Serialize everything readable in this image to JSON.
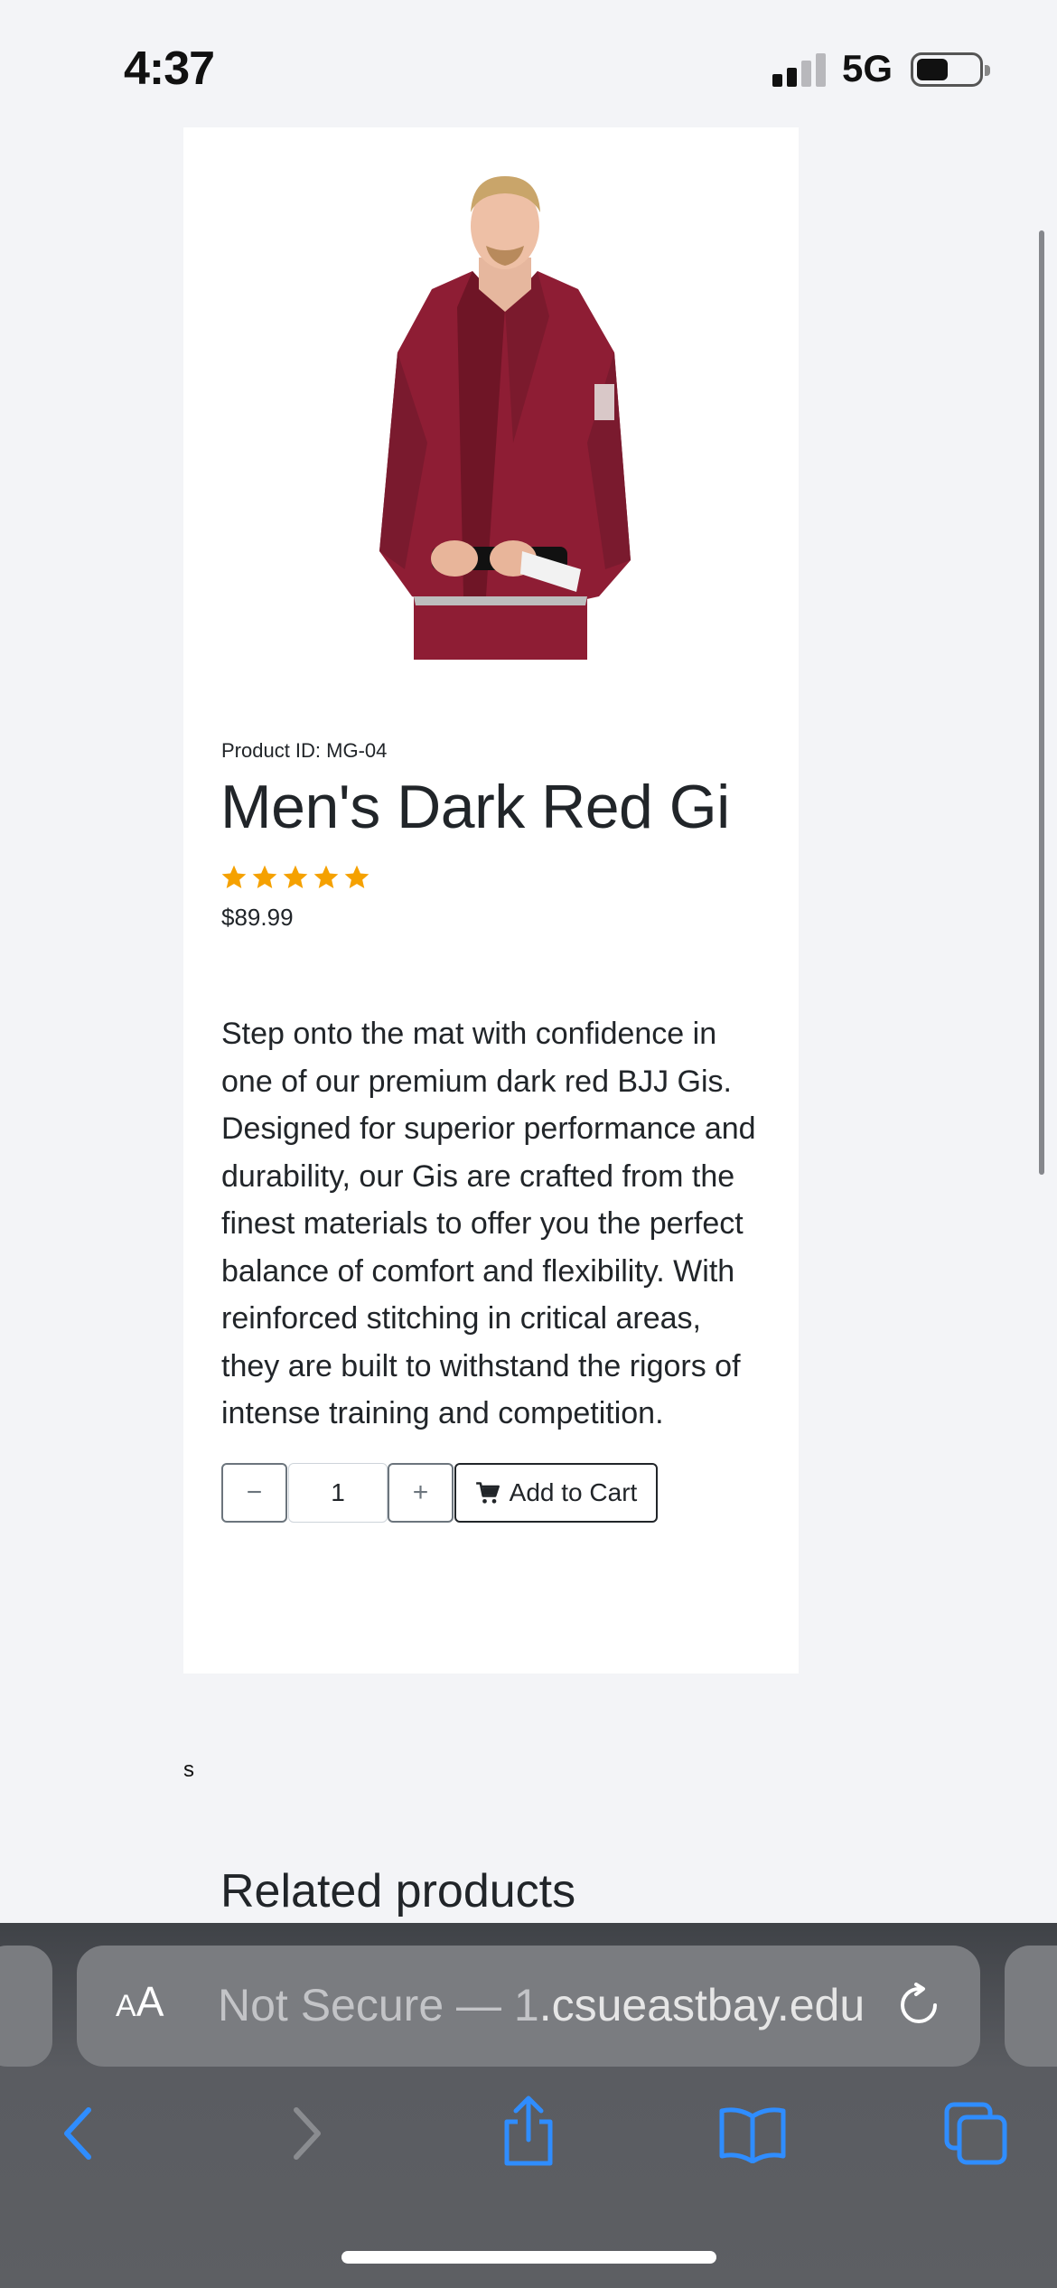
{
  "status_bar": {
    "time": "4:37",
    "network": "5G",
    "signal_bars_active": 2,
    "signal_bars_total": 4,
    "battery_level": 0.45
  },
  "product": {
    "product_id": "Product ID: MG-04",
    "title": "Men's Dark Red Gi",
    "rating": 5,
    "rating_max": 5,
    "rating_color": "#f5a100",
    "price": "$89.99",
    "description": "Step onto the mat with confidence in one of our premium dark red BJJ Gis. Designed for superior performance and durability, our Gis are crafted from the finest materials to offer you the perfect balance of comfort and flexibility. With reinforced stitching in critical areas, they are built to withstand the rigors of intense training and competition.",
    "image_icon": "gi-product-photo",
    "gi_color": "#8e1d34"
  },
  "cart": {
    "decrement_label": "−",
    "quantity": "1",
    "increment_label": "+",
    "add_label": "Add to Cart",
    "add_icon": "cart-icon"
  },
  "stray_text": "s",
  "related_heading": "Related products",
  "browser": {
    "aa_small": "A",
    "aa_large": "A",
    "url_dim": "Not Secure — 1",
    "url_domain": ".csueastbay.edu",
    "reload_icon": "reload-icon",
    "nav_icons": [
      "back-icon",
      "forward-icon",
      "share-icon",
      "bookmarks-icon",
      "tabs-icon"
    ],
    "accent_color": "#2f8dff"
  }
}
